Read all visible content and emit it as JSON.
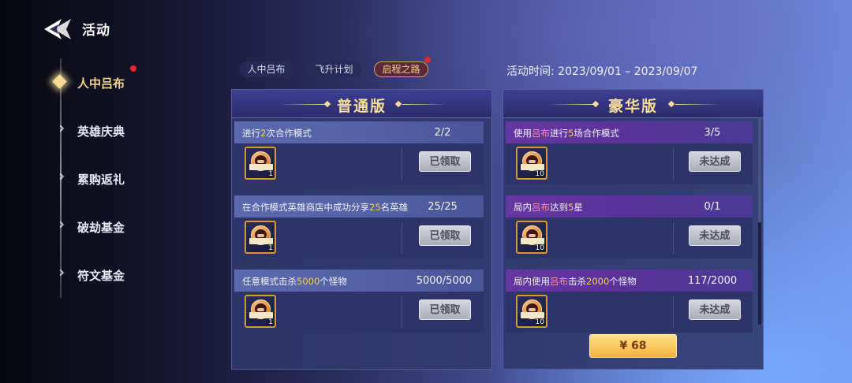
{
  "header": {
    "title": "活动",
    "back_icon": "back-arrow-icon"
  },
  "sidebar": {
    "items": [
      {
        "label": "人中吕布",
        "active": true,
        "badge": true
      },
      {
        "label": "英雄庆典",
        "active": false
      },
      {
        "label": "累购返礼",
        "active": false
      },
      {
        "label": "破劫基金",
        "active": false
      },
      {
        "label": "符文基金",
        "active": false
      }
    ]
  },
  "tabs": [
    {
      "label": "人中吕布",
      "active": false
    },
    {
      "label": "飞升计划",
      "active": false
    },
    {
      "label": "启程之路",
      "active": true,
      "badge": true
    }
  ],
  "activity_time": "活动时间:  2023/09/01 – 2023/09/07",
  "standard": {
    "title": "普通版",
    "tasks": [
      {
        "parts": [
          "进行",
          "2",
          "次合作模式"
        ],
        "progress": "2/2",
        "reward_count": "1",
        "button": "已领取"
      },
      {
        "parts": [
          "在合作模式英雄商店中成功分享",
          "25",
          "名英雄"
        ],
        "progress": "25/25",
        "reward_count": "1",
        "button": "已领取"
      },
      {
        "parts": [
          "任意模式击杀",
          "5000",
          "个怪物"
        ],
        "progress": "5000/5000",
        "reward_count": "1",
        "button": "已领取"
      }
    ]
  },
  "deluxe": {
    "title": "豪华版",
    "tasks": [
      {
        "parts": [
          "使用",
          "吕布",
          "进行",
          "5",
          "场合作模式"
        ],
        "progress": "3/5",
        "reward_count": "10",
        "button": "未达成"
      },
      {
        "parts": [
          "局内",
          "吕布",
          "达到",
          "5",
          "星"
        ],
        "progress": "0/1",
        "reward_count": "10",
        "button": "未达成"
      },
      {
        "parts": [
          "局内使用",
          "吕布",
          "击杀",
          "2000",
          "个怪物"
        ],
        "progress": "117/2000",
        "reward_count": "10",
        "button": "未达成"
      }
    ],
    "price_button": "¥ 68"
  },
  "colors": {
    "accent_gold": "#f7dc9c",
    "highlight_yellow": "#f2d15a",
    "highlight_pink": "#ff8fa6",
    "badge_red": "#e02a2a"
  }
}
